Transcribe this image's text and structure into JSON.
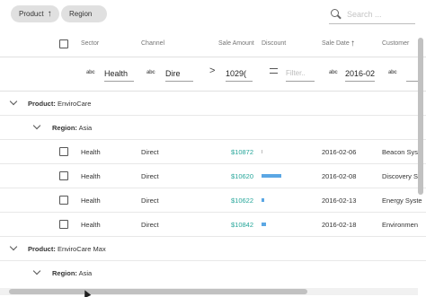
{
  "grouping": {
    "chips": [
      {
        "label": "Product",
        "sorted": true,
        "sort_arrow": "↑"
      },
      {
        "label": "Region",
        "sorted": false
      }
    ]
  },
  "search": {
    "placeholder": "Search ..."
  },
  "columns": {
    "sector": "Sector",
    "channel": "Channel",
    "sale_amount": "Sale Amount",
    "discount": "Discount",
    "sale_date": "Sale Date",
    "sale_date_arrow": "↑",
    "customer": "Customer"
  },
  "filters": {
    "abc_label": "abc",
    "sector": "Health",
    "channel": "Dire",
    "amount_operator": ">",
    "amount": "1029(",
    "discount_placeholder": "Filter..",
    "date": "2016-02",
    "customer": ""
  },
  "groups": [
    {
      "label": "Product:",
      "value": "EnviroCare",
      "level": 1
    },
    {
      "label": "Region:",
      "value": "Asia",
      "level": 2
    }
  ],
  "rows": [
    {
      "sector": "Health",
      "channel": "Direct",
      "amount": "$10872",
      "discount": 0.01,
      "date": "2016-02-06",
      "customer": "Beacon Syst"
    },
    {
      "sector": "Health",
      "channel": "Direct",
      "amount": "$10620",
      "discount": 0.35,
      "date": "2016-02-08",
      "customer": "Discovery S"
    },
    {
      "sector": "Health",
      "channel": "Direct",
      "amount": "$10622",
      "discount": 0.05,
      "date": "2016-02-13",
      "customer": "Energy Syste"
    },
    {
      "sector": "Health",
      "channel": "Direct",
      "amount": "$10842",
      "discount": 0.08,
      "date": "2016-02-18",
      "customer": "Environmen"
    }
  ],
  "groups_after": [
    {
      "label": "Product:",
      "value": "EnviroCare Max",
      "level": 1
    },
    {
      "label": "Region:",
      "value": "Asia",
      "level": 2
    }
  ],
  "colors": {
    "amount": "#26a69a",
    "discount_bar": "#5ba7e4"
  }
}
